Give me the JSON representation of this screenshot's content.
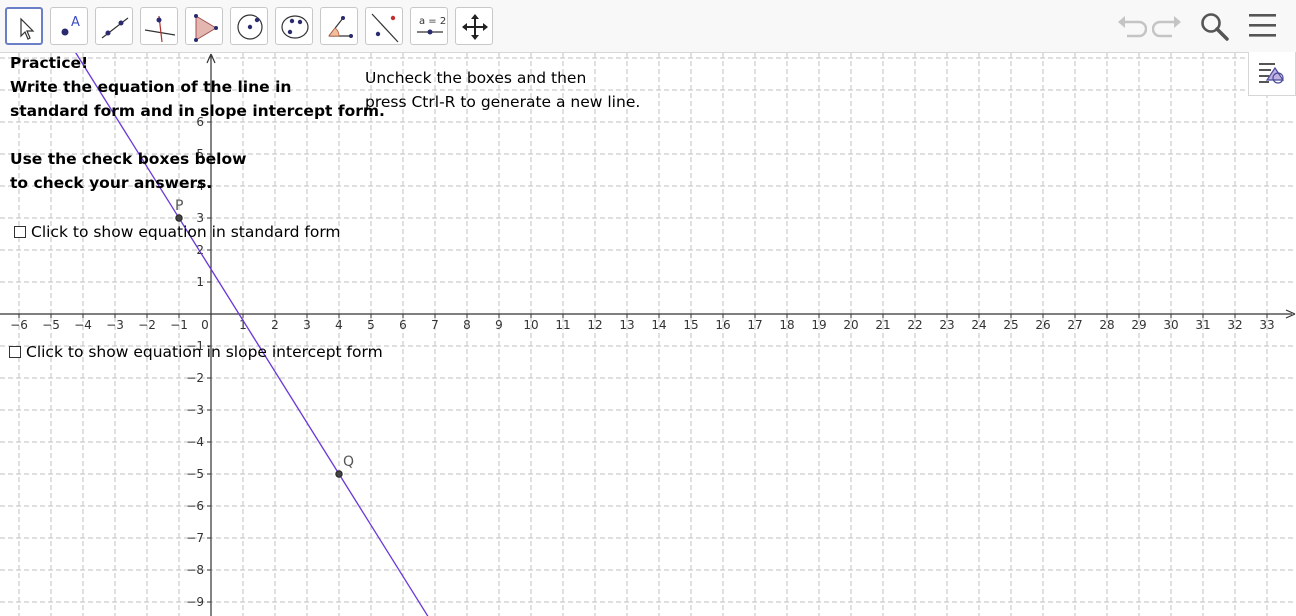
{
  "toolbar": {
    "tools": [
      {
        "name": "move-tool",
        "icon": "arrow-cursor-icon",
        "active": true
      },
      {
        "name": "point-tool",
        "icon": "point-icon",
        "label": "A"
      },
      {
        "name": "line-tool",
        "icon": "line-icon"
      },
      {
        "name": "perpendicular-tool",
        "icon": "perpendicular-icon"
      },
      {
        "name": "polygon-tool",
        "icon": "polygon-icon"
      },
      {
        "name": "circle-tool",
        "icon": "circle-icon"
      },
      {
        "name": "conic-tool",
        "icon": "ellipse-icon"
      },
      {
        "name": "angle-tool",
        "icon": "angle-icon"
      },
      {
        "name": "reflect-tool",
        "icon": "reflect-icon"
      },
      {
        "name": "slider-tool",
        "icon": "slider-icon",
        "label": "a = 2"
      },
      {
        "name": "move-graphics-tool",
        "icon": "move-arrows-icon"
      }
    ],
    "right": [
      "undo-icon",
      "redo-icon",
      "search-icon",
      "menu-icon"
    ]
  },
  "texts": {
    "practice": [
      "Practice!",
      "Write the equation of the line in",
      "standard form and in slope intercept form.",
      "",
      "Use the check boxes below",
      "to check your answers."
    ],
    "instructions": [
      "Uncheck the boxes and then",
      "press Ctrl-R to generate a new line."
    ]
  },
  "checkboxes": {
    "standard": "Click to show equation in standard form",
    "slope": "Click to show equation in slope intercept form"
  },
  "points": {
    "P": {
      "label": "P",
      "x": -1,
      "y": 3
    },
    "Q": {
      "label": "Q",
      "x": 4,
      "y": -5
    }
  },
  "axes": {
    "x_ticks": [
      -6,
      -5,
      -4,
      -3,
      -2,
      -1,
      0,
      1,
      2,
      3,
      4,
      5,
      6,
      7,
      8,
      9,
      10,
      11,
      12,
      13,
      14,
      15,
      16,
      17,
      18,
      19,
      20,
      21,
      22,
      23,
      24,
      25,
      26,
      27,
      28,
      29,
      30,
      31,
      32,
      33
    ],
    "y_ticks": [
      6,
      5,
      4,
      3,
      2,
      1,
      -1,
      -2,
      -3,
      -4,
      -5,
      -6,
      -7,
      -8,
      -9
    ]
  },
  "colors": {
    "line": "#6a37d8",
    "grid": "#c0c0c0",
    "axis": "#333333",
    "active": "#6b7fc7"
  }
}
